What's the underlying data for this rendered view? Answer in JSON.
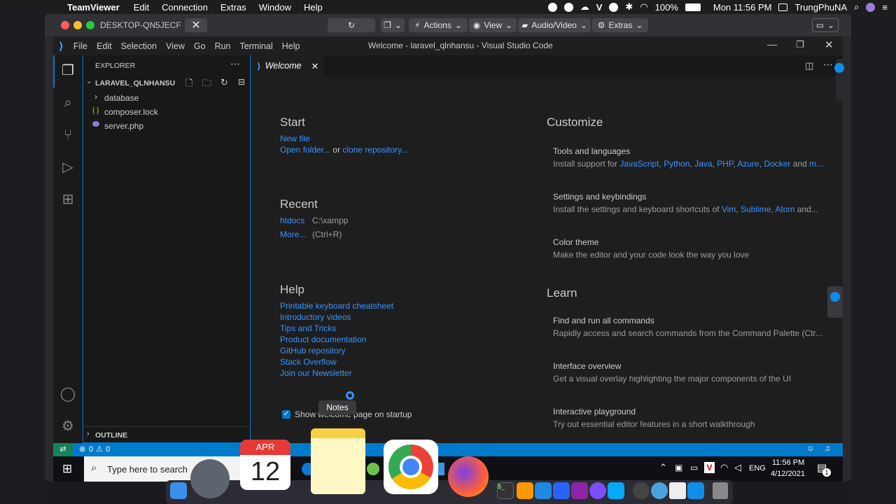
{
  "mac_menubar": {
    "app": "TeamViewer",
    "menus": [
      "Edit",
      "Connection",
      "Extras",
      "Window",
      "Help"
    ],
    "battery": "100%",
    "clock": "Mon 11:56 PM",
    "user": "TrungPhuNA"
  },
  "teamviewer": {
    "title": "DESKTOP-QN5JECF",
    "actions": "Actions",
    "view": "View",
    "audio_video": "Audio/Video",
    "extras": "Extras"
  },
  "vscode": {
    "menus": [
      "File",
      "Edit",
      "Selection",
      "View",
      "Go",
      "Run",
      "Terminal",
      "Help"
    ],
    "window_title": "Welcome - laravel_qlnhansu - Visual Studio Code",
    "explorer": {
      "header": "EXPLORER",
      "project": "LARAVEL_QLNHANSU",
      "items": [
        {
          "name": "database",
          "icon": ">"
        },
        {
          "name": "composer.lock",
          "icon": "{}"
        },
        {
          "name": "server.php",
          "icon": "php"
        }
      ],
      "outline": "OUTLINE"
    },
    "tab": "Welcome",
    "start": {
      "heading": "Start",
      "new_file": "New file",
      "open_folder": "Open folder...",
      "or": "or",
      "clone": "clone repository..."
    },
    "recent": {
      "heading": "Recent",
      "items": [
        {
          "name": "htdocs",
          "path": "C:\\xampp"
        },
        {
          "name": "More...",
          "path": "(Ctrl+R)"
        }
      ]
    },
    "help": {
      "heading": "Help",
      "links": [
        "Printable keyboard cheatsheet",
        "Introductory videos",
        "Tips and Tricks",
        "Product documentation",
        "GitHub repository",
        "Stack Overflow",
        "Join our Newsletter"
      ]
    },
    "show_welcome": "Show welcome page on startup",
    "customize": {
      "heading": "Customize",
      "tools_title": "Tools and languages",
      "tools_prefix": "Install support for",
      "tools_links": [
        "JavaScript",
        "Python",
        "Java",
        "PHP",
        "Azure",
        "Docker"
      ],
      "tools_and": "and",
      "tools_more": "m...",
      "settings_title": "Settings and keybindings",
      "settings_prefix": "Install the settings and keyboard shortcuts of",
      "settings_links": [
        "Vim",
        "Sublime",
        "Atom"
      ],
      "settings_suffix": "and...",
      "color_title": "Color theme",
      "color_desc": "Make the editor and your code look the way you love"
    },
    "learn": {
      "heading": "Learn",
      "items": [
        {
          "title": "Find and run all commands",
          "desc": "Rapidly access and search commands from the Command Palette (Ctr..."
        },
        {
          "title": "Interface overview",
          "desc": "Get a visual overlay highlighting the major components of the UI"
        },
        {
          "title": "Interactive playground",
          "desc": "Try out essential editor features in a short walkthrough"
        }
      ]
    },
    "status": {
      "errors": "0",
      "warnings": "0"
    }
  },
  "windows_taskbar": {
    "search_placeholder": "Type here to search",
    "lang": "ENG",
    "time": "11:56 PM",
    "date": "4/12/2021",
    "notif_count": "1"
  },
  "dock": {
    "tooltip": "Notes",
    "calendar_month": "APR",
    "calendar_day": "12"
  }
}
